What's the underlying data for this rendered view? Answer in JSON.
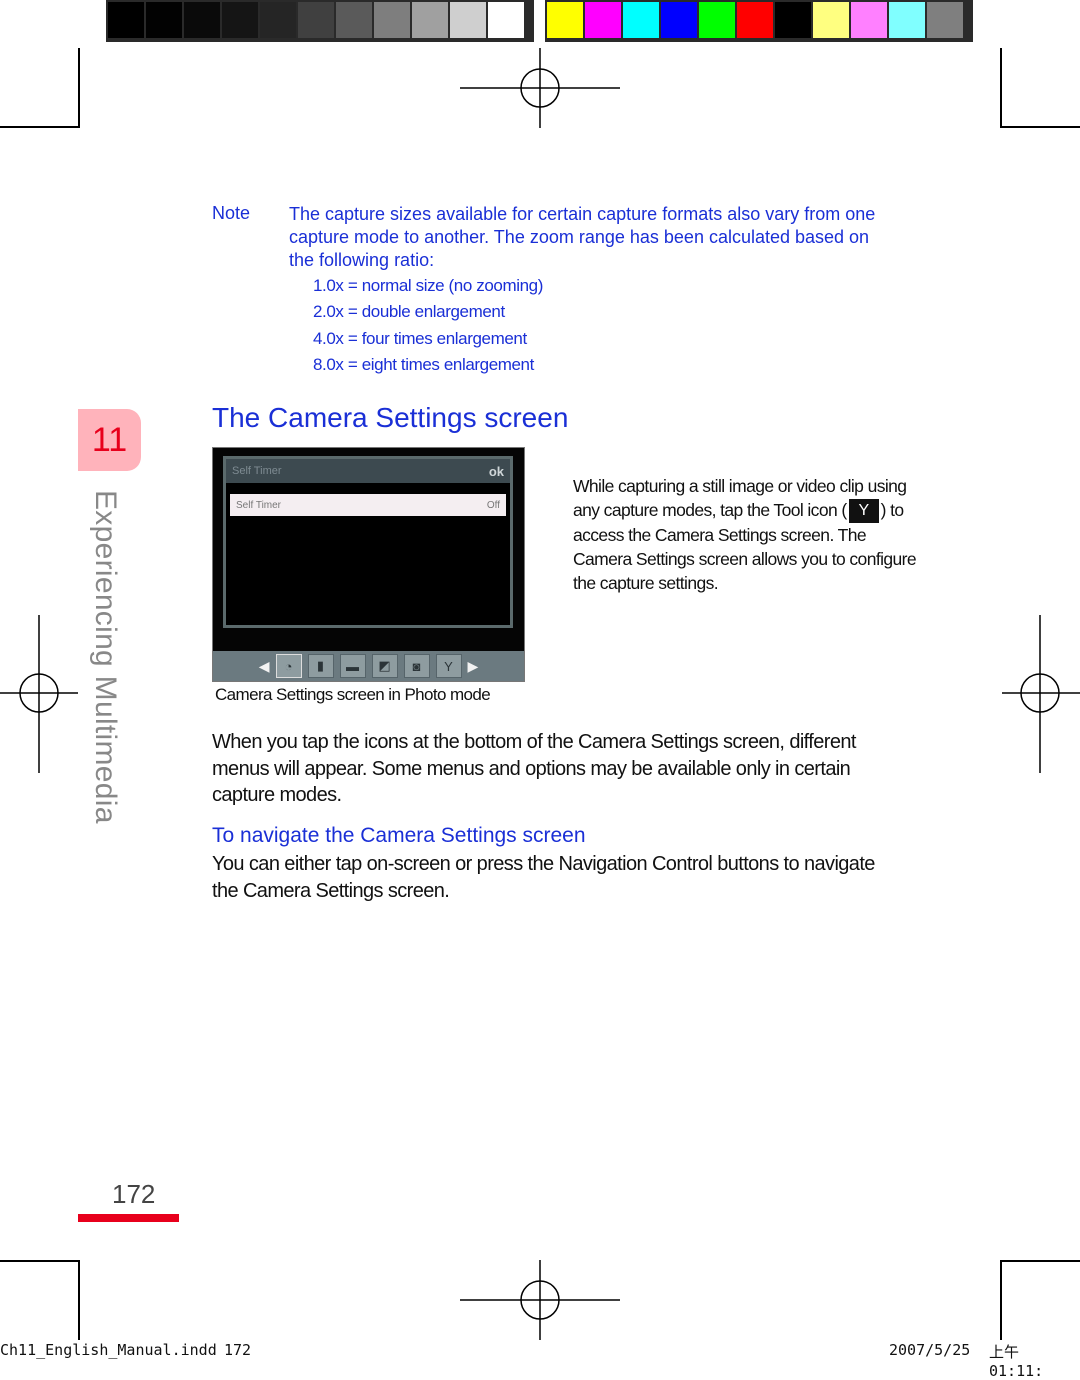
{
  "color_bars": {
    "grayscale": [
      "#000000",
      "#020202",
      "#0a0a0a",
      "#151515",
      "#252525",
      "#404040",
      "#5a5a5a",
      "#7e7e7e",
      "#a0a0a0",
      "#cfcfcf",
      "#ffffff"
    ],
    "colors": [
      "#ffff00",
      "#ff00ff",
      "#00ffff",
      "#0000ff",
      "#00ff00",
      "#ff0000",
      "#000000",
      "#ffff80",
      "#ff80ff",
      "#80ffff",
      "#7f7f7f"
    ]
  },
  "note": {
    "label": "Note",
    "text": "The capture sizes available for certain capture formats also vary from one capture mode to another. The zoom range has been calculated based on the following ratio:",
    "ratios": [
      "1.0x = normal size (no zooming)",
      "2.0x = double enlargement",
      "4.0x = four times enlargement",
      "8.0x = eight times enlargement"
    ]
  },
  "chapter": {
    "number": "11",
    "title": "Experiencing Multimedia"
  },
  "section": {
    "title": "The Camera Settings screen"
  },
  "phone_screen": {
    "header_title": "Self Timer",
    "ok_label": "ok",
    "row_label": "Self Timer",
    "row_value": "Off",
    "toolbar_icons": [
      "arrow-left-icon",
      "self-timer-icon",
      "storage-icon",
      "capture-mode-icon",
      "ambience-icon",
      "camera-icon",
      "tool-icon",
      "arrow-right-icon"
    ]
  },
  "figure_caption": "Camera Settings screen in Photo mode",
  "side_text": {
    "before_icon": "While capturing a still image or video clip using any capture modes, tap the Tool icon (",
    "after_icon": ") to access the Camera Settings screen. The Camera Settings screen allows you to configure the capture settings."
  },
  "body": {
    "paragraph1": "When you tap the icons at the bottom of the Camera Settings screen, different menus will appear. Some menus and options may be available only in certain capture modes.",
    "subheading": "To navigate the Camera Settings screen",
    "paragraph2": "You can either tap on-screen or press the Navigation Control buttons to navigate the Camera Settings screen."
  },
  "page_number": "172",
  "footer": {
    "filename": "Ch11_English_Manual.indd",
    "page": "172",
    "date": "2007/5/25",
    "time": "上午 01:11:"
  }
}
